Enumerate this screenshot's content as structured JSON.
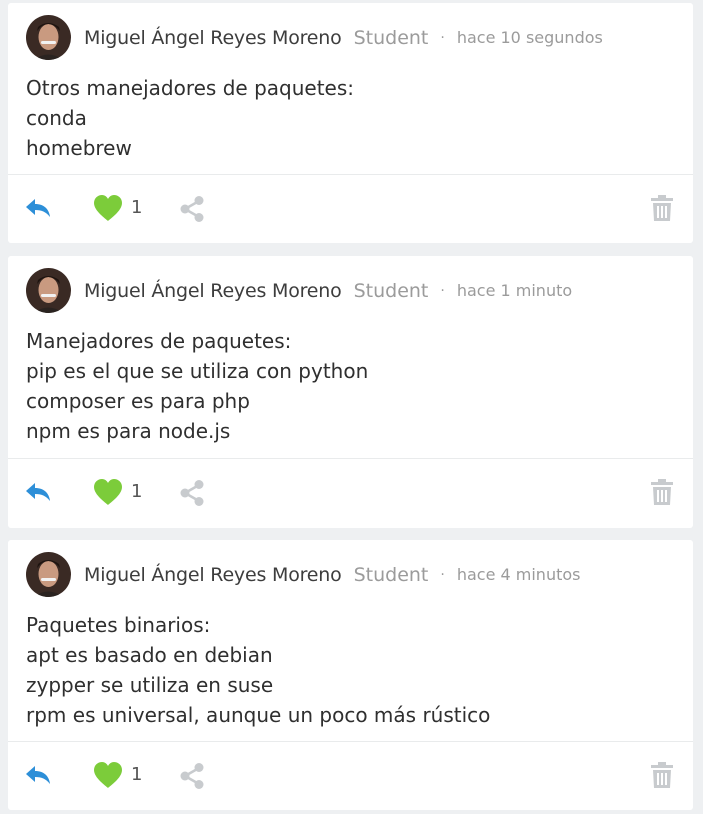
{
  "posts": [
    {
      "author": "Miguel Ángel Reyes Moreno",
      "role": "Student",
      "separator": "·",
      "time": "hace 10 segundos",
      "lines": [
        "Otros manejadores de paquetes:",
        "conda",
        "homebrew"
      ],
      "likes": "1"
    },
    {
      "author": "Miguel Ángel Reyes Moreno",
      "role": "Student",
      "separator": "·",
      "time": "hace 1 minuto",
      "lines": [
        "Manejadores de paquetes:",
        "pip es el que se utiliza con python",
        "composer es para php",
        "npm es para node.js"
      ],
      "likes": "1"
    },
    {
      "author": "Miguel Ángel Reyes Moreno",
      "role": "Student",
      "separator": "·",
      "time": "hace 4 minutos",
      "lines": [
        "Paquetes binarios:",
        "apt es basado en debian",
        "zypper se utiliza en suse",
        "rpm es universal, aunque un poco más rústico"
      ],
      "likes": "1"
    }
  ],
  "colors": {
    "reply": "#2d8fd8",
    "like": "#7ccc3a",
    "share": "#c8cbce",
    "trash": "#c8cbce",
    "meta": "#9b9b9b"
  },
  "icons": {
    "reply": "reply-arrow-icon",
    "like": "heart-icon",
    "share": "share-icon",
    "trash": "trash-icon",
    "avatar": "user-avatar"
  }
}
